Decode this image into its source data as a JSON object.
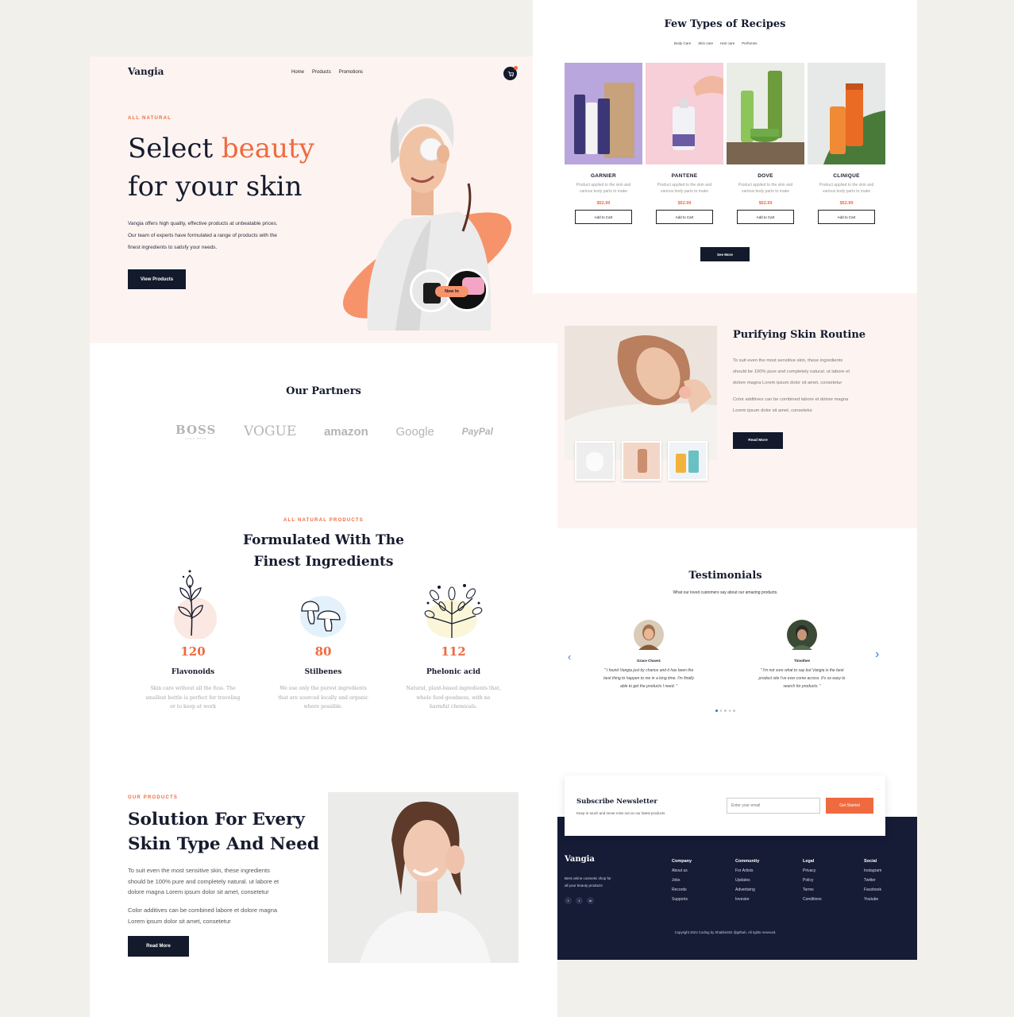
{
  "colors": {
    "accent": "#ef6a3f",
    "navy": "#121a2c",
    "blush": "#fdf4f1",
    "page_bg": "#f1f0eb"
  },
  "brand": "Vangia",
  "nav": {
    "items": [
      "Home",
      "Products",
      "Promotions"
    ],
    "cart_icon": "cart-icon"
  },
  "hero": {
    "eyebrow": "ALL NATURAL",
    "title_part1": "Select ",
    "title_accent": "beauty",
    "title_line2": "for your skin",
    "desc_line1": "Vangia offers high quality, effective products at unbeatable prices.",
    "desc_line2": "Our team of experts have formulated a range of products with the",
    "desc_line3": "finest ingredients to satisfy your needs.",
    "cta": "View Products",
    "badge": "New In"
  },
  "partners": {
    "title": "Our Partners",
    "logos": [
      "BOSS",
      "VOGUE",
      "amazon",
      "Google",
      "PayPal"
    ],
    "boss_sub": "HUGO BOSS"
  },
  "ingredients": {
    "eyebrow": "ALL NATURAL PRODUCTS",
    "title_line1": "Formulated With The",
    "title_line2": "Finest Ingredients",
    "items": [
      {
        "count": "120",
        "name": "Flavonoids",
        "desc1": "Skin care without all the fuss. The",
        "desc2": "smallest bottle is perfect for traveling",
        "desc3": "or to keep at work"
      },
      {
        "count": "80",
        "name": "Stilbenes",
        "desc1": "We use only the purest ingredients",
        "desc2": "that are sourced locally and organic",
        "desc3": "where possible."
      },
      {
        "count": "112",
        "name": "Phelonic acid",
        "desc1": "Natural, plant-based ingredients that,",
        "desc2": "whole food goodness, with no",
        "desc3": "harmful chemicals."
      }
    ]
  },
  "solution": {
    "eyebrow": "OUR PRODUCTS",
    "title_line1": "Solution For Every",
    "title_line2": "Skin Type And Need",
    "p1_line1": "To suit even the most sensitive skin, these ingredients",
    "p1_line2": "should be 100% pure and completely natural. ut labore et",
    "p1_line3": "dolore magna Lorem ipsum dolor sit amet, consetetur",
    "p2_line1": "Color additives can be combined labore et dolore magna",
    "p2_line2": "Lorem ipsum dolor sit amet, consetetur",
    "cta": "Read More"
  },
  "recipes": {
    "title": "Few Types of Recipes",
    "tabs": [
      "Body Care",
      "Skin care",
      "Hair care",
      "Perfumes"
    ],
    "products": [
      {
        "name": "GARNIER",
        "desc1": "Product applied to the skin and",
        "desc2": "various body parts to make",
        "price": "$52.99",
        "cta": "Add to Cart"
      },
      {
        "name": "PANTENE",
        "desc1": "Product applied to the skin and",
        "desc2": "various body parts to make",
        "price": "$52.99",
        "cta": "Add to Cart"
      },
      {
        "name": "DOVE",
        "desc1": "Product applied to the skin and",
        "desc2": "various body parts to make",
        "price": "$52.99",
        "cta": "Add to Cart"
      },
      {
        "name": "CLINIQUE",
        "desc1": "Product applied to the skin and",
        "desc2": "various body parts to make",
        "price": "$52.99",
        "cta": "Add to Cart"
      }
    ],
    "see_more": "See More"
  },
  "routine": {
    "title": "Purifying Skin Routine",
    "p1_line1": "To suit even the most sensitive skin, these ingredients",
    "p1_line2": "should be 100% pure and completely natural. ut labore et",
    "p1_line3": "dolore magna Lorem ipsum dolor sit amet, consetetur",
    "p2_line1": "Color additives can be combined labore et dolore magna",
    "p2_line2": "Lorem ipsum dolor sit amet, consetetur",
    "cta": "Read More"
  },
  "testimonials": {
    "title": "Testimonials",
    "subtitle": "What our loved customers say about our amazing products.",
    "items": [
      {
        "name": "Grace Chavez",
        "q1": "\" I found Vangia just by chance and it has been the",
        "q2": "best thing to happen to me in a long time. I'm finally",
        "q3": "able to get the products I need. \""
      },
      {
        "name": "Timothee",
        "q1": "\" I'm not sure what to say but Vangia is the best",
        "q2": "product site I've ever come across. It's so easy to",
        "q3": "search for products. \""
      }
    ],
    "dots": 5,
    "active_dot": 1
  },
  "newsletter": {
    "title": "Subscribe Newsletter",
    "subtitle": "Keep in touch and never miss out on our latest products",
    "placeholder": "Enter your email",
    "cta": "Get Started"
  },
  "footer": {
    "brand": "Vangia",
    "tagline1": "Best online cosmetic shop for",
    "tagline2": "all your beauty products",
    "socials": [
      "f",
      "t",
      "in"
    ],
    "columns": [
      {
        "title": "Company",
        "items": [
          "About us",
          "Jobs",
          "Records",
          "Supports"
        ]
      },
      {
        "title": "Community",
        "items": [
          "For Artists",
          "Updates",
          "Advertising",
          "Investor"
        ]
      },
      {
        "title": "Legal",
        "items": [
          "Privacy",
          "Policy",
          "Terms",
          "Conditions"
        ]
      },
      {
        "title": "Social",
        "items": [
          "Instagram",
          "Twitter",
          "Facebook",
          "Youtube"
        ]
      }
    ],
    "copyright": "Copyright 2022 Coding by Shabbir402 @github. All rights reserved."
  }
}
